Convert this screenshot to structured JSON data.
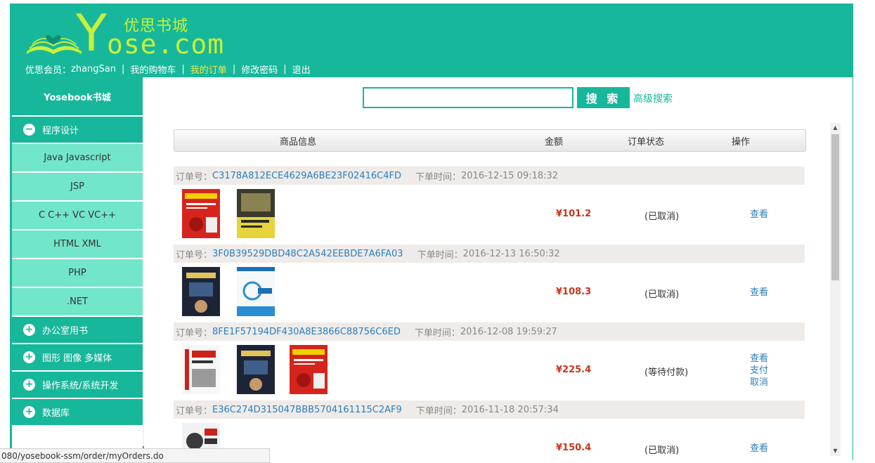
{
  "logo": {
    "cn": "优思书城",
    "en": "ose.com",
    "y": "Y"
  },
  "topnav": {
    "member_label": "优思会员：",
    "username": "zhangSan",
    "cart": "我的购物车",
    "orders": "我的订单",
    "change_password": "修改密码",
    "logout": "退出"
  },
  "sidebar": {
    "title": "Yosebook书城",
    "categories": [
      {
        "label": "程序设计",
        "icon": "minus-circle-icon",
        "expanded": true,
        "subs": [
          "Java Javascript",
          "JSP",
          "C C++ VC VC++",
          "HTML XML",
          "PHP",
          ".NET"
        ]
      },
      {
        "label": "办公室用书",
        "icon": "plus-circle-icon"
      },
      {
        "label": "图形 图像 多媒体",
        "icon": "plus-circle-icon"
      },
      {
        "label": "操作系统/系统开发",
        "icon": "plus-circle-icon"
      },
      {
        "label": "数据库",
        "icon": "plus-circle-icon"
      }
    ]
  },
  "search": {
    "placeholder": "",
    "button": "搜 索",
    "advanced": "高级搜索"
  },
  "table_header": {
    "product": "商品信息",
    "amount": "金额",
    "status": "订单状态",
    "ops": "操作"
  },
  "order_labels": {
    "id_label": "订单号：",
    "time_label": "下单时间："
  },
  "orders": [
    {
      "id": "C3178A812ECE4629A6BE23F02416C4FD",
      "time": "2016-12-15 09:18:32",
      "price": "¥101.2",
      "status": "(已取消)",
      "ops": [
        "查看"
      ]
    },
    {
      "id": "3F0B39529DBD48C2A542EEBDE7A6FA03",
      "time": "2016-12-13 16:50:32",
      "price": "¥108.3",
      "status": "(已取消)",
      "ops": [
        "查看"
      ]
    },
    {
      "id": "8FE1F57194DF430A8E3866C88756C6ED",
      "time": "2016-12-08 19:59:27",
      "price": "¥225.4",
      "status": "(等待付款)",
      "ops": [
        "查看",
        "支付",
        "取消"
      ]
    },
    {
      "id": "E36C274D315047BBB5704161115C2AF9",
      "time": "2016-11-18 20:57:34",
      "price": "¥150.4",
      "status": "(已取消)",
      "ops": [
        "查看"
      ]
    }
  ],
  "status_url": "080/yosebook-ssm/order/myOrders.do",
  "colors": {
    "accent": "#17b79b",
    "sub_bg": "#72e6c8",
    "price": "#c8341a",
    "link": "#2a7fc0"
  }
}
